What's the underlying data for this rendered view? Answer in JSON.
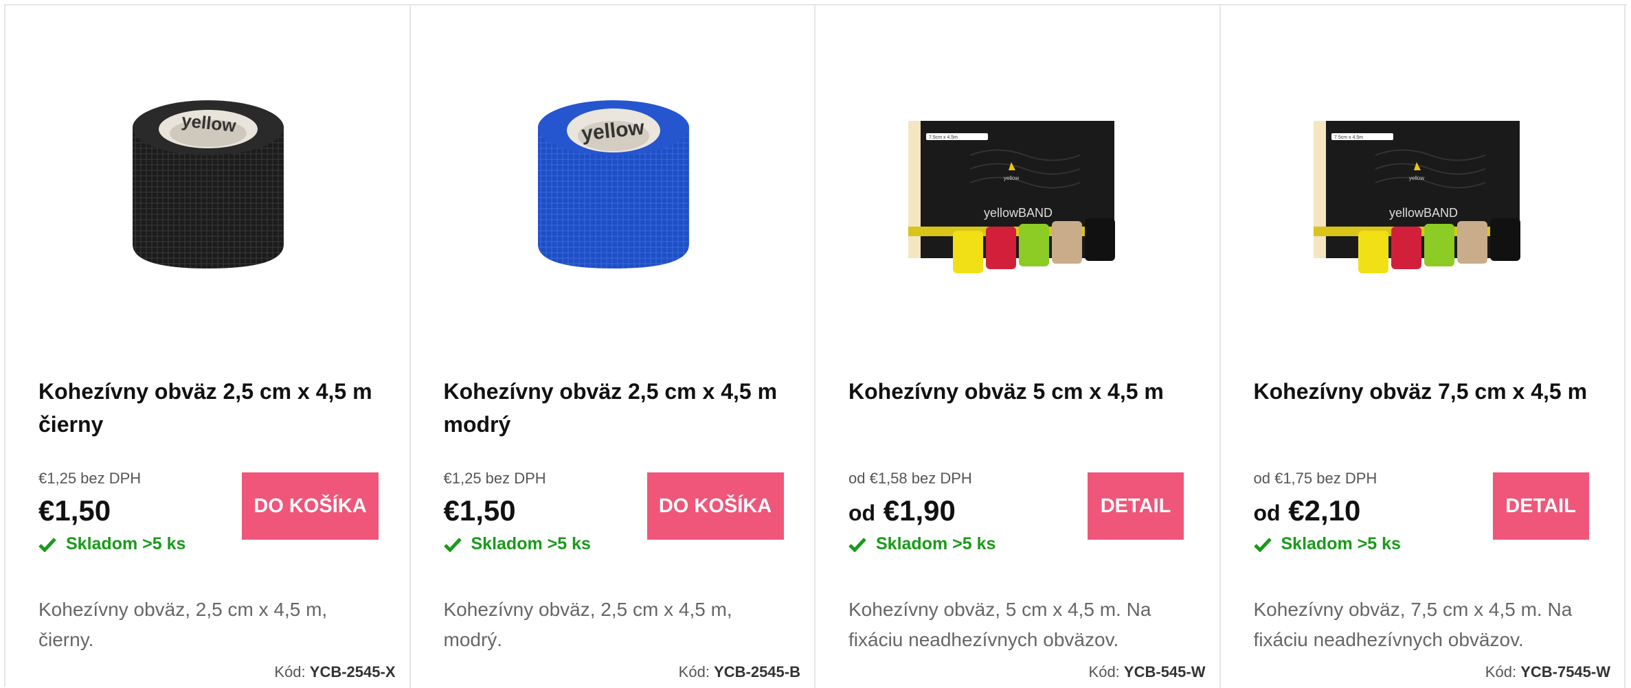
{
  "products": [
    {
      "image": "cohesive-bandage-roll-black",
      "title": "Kohezívny obväz 2,5 cm x 4,5 m čierny",
      "price_net": "€1,25 bez DPH",
      "price_prefix": "",
      "price": "€1,50",
      "stock": "Skladom >5 ks",
      "button": "DO KOŠÍKA",
      "description": "Kohezívny obväz, 2,5 cm x 4,5 m, čierny.",
      "code_label": "Kód:",
      "code": "YCB-2545-X",
      "roll_color": "#1c1c1c"
    },
    {
      "image": "cohesive-bandage-roll-blue",
      "title": "Kohezívny obväz 2,5 cm x 4,5 m modrý",
      "price_net": "€1,25 bez DPH",
      "price_prefix": "",
      "price": "€1,50",
      "stock": "Skladom >5 ks",
      "button": "DO KOŠÍKA",
      "description": "Kohezívny obväz, 2,5 cm x 4,5 m, modrý.",
      "code_label": "Kód:",
      "code": "YCB-2545-B",
      "roll_color": "#1f4fc4"
    },
    {
      "image": "cohesive-bandage-box-set",
      "title": "Kohezívny obväz 5 cm x 4,5 m",
      "price_net": "od €1,58 bez DPH",
      "price_prefix": "od",
      "price": "€1,90",
      "stock": "Skladom >5 ks",
      "button": "DETAIL",
      "description": "Kohezívny obväz, 5 cm x 4,5 m. Na fixáciu neadhezívnych obväzov.",
      "code_label": "Kód:",
      "code": "YCB-545-W",
      "box_label": "7.5cm x 4.5m",
      "box_brand": "yellowBAND"
    },
    {
      "image": "cohesive-bandage-box-set",
      "title": "Kohezívny obväz 7,5 cm x 4,5 m",
      "price_net": "od €1,75 bez DPH",
      "price_prefix": "od",
      "price": "€2,10",
      "stock": "Skladom >5 ks",
      "button": "DETAIL",
      "description": "Kohezívny obväz, 7,5 cm x 4,5 m. Na fixáciu neadhezívnych obväzov.",
      "code_label": "Kód:",
      "code": "YCB-7545-W",
      "box_label": "7.5cm x 4.5m",
      "box_brand": "yellowBAND"
    }
  ],
  "roll_brand": "yellow",
  "colors": {
    "accent": "#f0557a",
    "stock_green": "#1a9a1a",
    "border": "#e6e6e6"
  }
}
